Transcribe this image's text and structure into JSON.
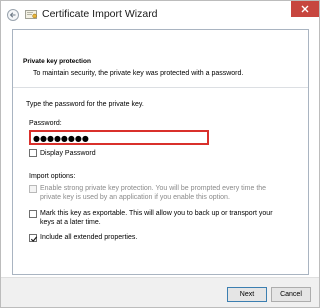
{
  "window": {
    "title": "Certificate Import Wizard",
    "close_glyph": "✕",
    "accent_close": "#c7463f"
  },
  "header": {
    "section_title": "Private key protection",
    "section_desc": "To maintain security, the private key was protected with a password."
  },
  "main": {
    "intro": "Type the password for the private key.",
    "password_label": "Password:",
    "password_value": "●●●●●●●●",
    "display_password_label": "Display Password",
    "display_password_checked": false,
    "import_options_label": "Import options:",
    "options": [
      {
        "line1": "Enable strong private key protection. You will be prompted every time the",
        "line2": "private key is used by an application if you enable this option.",
        "checked": false,
        "enabled": false
      },
      {
        "line1": "Mark this key as exportable. This will allow you to back up or transport your",
        "line2": "keys at a later time.",
        "checked": false,
        "enabled": true
      },
      {
        "line1": "Include all extended properties.",
        "line2": "",
        "checked": true,
        "enabled": true
      }
    ]
  },
  "footer": {
    "next_label": "Next",
    "cancel_label": "Cancel"
  },
  "colors": {
    "highlight_border": "#d9302b",
    "panel_border": "#a9b4c1"
  }
}
